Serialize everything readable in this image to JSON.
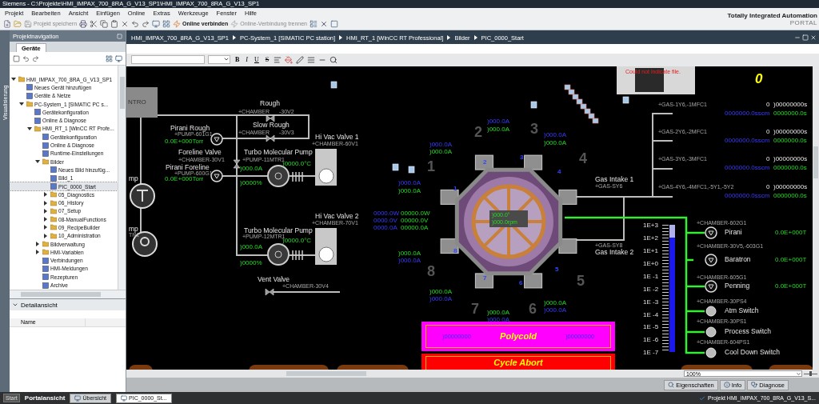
{
  "window": {
    "title": "Siemens - C:\\Projekte\\HMI_IMPAX_700_8RA_G_V13_SP1\\HMI_IMPAX_700_8RA_G_V13_SP1"
  },
  "menu": [
    "Projekt",
    "Bearbeiten",
    "Ansicht",
    "Einfügen",
    "Online",
    "Extras",
    "Werkzeuge",
    "Fenster",
    "Hilfe"
  ],
  "branding": {
    "title": "Totally Integrated Automation",
    "subtitle": "PORTAL"
  },
  "toolbar": [
    {
      "label": "Projekt speichern",
      "disabled": true
    },
    {
      "label": "Online verbinden",
      "disabled": false
    },
    {
      "label": "Online-Verbindung trennen",
      "disabled": true
    }
  ],
  "side_tab": "Visualisierung",
  "project_navigation": {
    "title": "Projektnavigation",
    "tabs": [
      {
        "label": "Geräte",
        "selected": true
      }
    ],
    "tree": [
      {
        "label": "HMI_IMPAX_700_8RA_G_V13_SP1",
        "selected": false,
        "expanded": true,
        "children": [
          {
            "label": "Neues Gerät hinzufügen",
            "selected": false
          },
          {
            "label": "Geräte & Netze",
            "selected": false
          },
          {
            "label": "PC-System_1 [SIMATIC PC s...",
            "selected": false,
            "expanded": true,
            "children": [
              {
                "label": "Gerätekonfiguration",
                "selected": false
              },
              {
                "label": "Online & Diagnose",
                "selected": false
              },
              {
                "label": "HMI_RT_1 [WinCC RT Profe...",
                "selected": false,
                "expanded": true,
                "children": [
                  {
                    "label": "Gerätekonfiguration",
                    "selected": false
                  },
                  {
                    "label": "Online & Diagnose",
                    "selected": false
                  },
                  {
                    "label": "Runtime-Einstellungen",
                    "selected": false
                  },
                  {
                    "label": "Bilder",
                    "selected": false,
                    "expanded": true,
                    "children": [
                      {
                        "label": "Neues Bild hinzufüg...",
                        "selected": false
                      },
                      {
                        "label": "Bild_1",
                        "selected": false
                      },
                      {
                        "label": "PIC_0000_Start",
                        "selected": true
                      },
                      {
                        "label": "05_Diagnostics",
                        "selected": false,
                        "expanded": false
                      },
                      {
                        "label": "06_History",
                        "selected": false,
                        "expanded": false
                      },
                      {
                        "label": "07_Setup",
                        "selected": false,
                        "expanded": false
                      },
                      {
                        "label": "08-ManualFunctions",
                        "selected": false,
                        "expanded": false
                      },
                      {
                        "label": "09_RecipeBuilder",
                        "selected": false,
                        "expanded": false
                      },
                      {
                        "label": "10_Administration",
                        "selected": false,
                        "expanded": false
                      }
                    ]
                  },
                  {
                    "label": "Bildverwaltung",
                    "selected": false,
                    "expanded": false
                  },
                  {
                    "label": "HMI-Variablen",
                    "selected": false,
                    "expanded": false
                  },
                  {
                    "label": "Verbindungen",
                    "selected": false
                  },
                  {
                    "label": "HMI-Meldungen",
                    "selected": false
                  },
                  {
                    "label": "Rezepturen",
                    "selected": false
                  },
                  {
                    "label": "Archive",
                    "selected": false
                  }
                ]
              }
            ]
          }
        ]
      }
    ]
  },
  "detail_view": {
    "title": "Detailansicht",
    "columns": [
      "Name"
    ]
  },
  "breadcrumb": [
    "HMI_IMPAX_700_8RA_G_V13_SP1",
    "PC-System_1 [SIMATIC PC station]",
    "HMI_RT_1 [WinCC RT Professional]",
    "Bilder",
    "PIC_0000_Start"
  ],
  "format_toolbar": {
    "buttons": [
      "B",
      "I",
      "U",
      "S"
    ]
  },
  "canvas": {
    "intro_button": "NTRO",
    "error_message": "Could not indicate file.",
    "counter": "0",
    "labels": [
      {
        "kind": "name",
        "text": "Rough"
      },
      {
        "kind": "tag",
        "text": "+CHAMBER"
      },
      {
        "kind": "tag",
        "text": "-30V2"
      },
      {
        "kind": "name",
        "text": "Slow Rough"
      },
      {
        "kind": "tag",
        "text": "+CHAMBER"
      },
      {
        "kind": "tag",
        "text": "-30V3"
      },
      {
        "kind": "name",
        "text": "Pirani Rough"
      },
      {
        "kind": "tag",
        "text": "+PUMP-601G1"
      },
      {
        "kind": "actual",
        "text": "0.0E+000Torr"
      },
      {
        "kind": "name",
        "text": "Hi Vac Valve 1"
      },
      {
        "kind": "tag",
        "text": "+CHAMBER-60V1"
      },
      {
        "kind": "name",
        "text": "Foreline Valve"
      },
      {
        "kind": "tag",
        "text": "+CHAMBER-30V1"
      },
      {
        "kind": "name",
        "text": "Turbo Molecular Pump"
      },
      {
        "kind": "tag",
        "text": "+PUMP-11MTR1"
      },
      {
        "kind": "actual",
        "text": ")0000.0°C"
      },
      {
        "kind": "name",
        "text": "Pirani Foreline"
      },
      {
        "kind": "tag",
        "text": "+PUMP-600G1"
      },
      {
        "kind": "actual",
        "text": "0.0E+000Torr"
      },
      {
        "kind": "actual",
        "text": ")000.0A"
      },
      {
        "kind": "actual",
        "text": ")0000%"
      },
      {
        "kind": "name",
        "text": "mp"
      },
      {
        "kind": "name",
        "text": "mp"
      },
      {
        "kind": "tag",
        "text": "TR1"
      },
      {
        "kind": "name",
        "text": "Hi Vac Valve 2"
      },
      {
        "kind": "tag",
        "text": "+CHAMBER-70V1"
      },
      {
        "kind": "name",
        "text": "Turbo Molecular Pump"
      },
      {
        "kind": "tag",
        "text": "+PUMP-12MTR1"
      },
      {
        "kind": "actual",
        "text": ")0000.0°C"
      },
      {
        "kind": "actual",
        "text": ")000.0A"
      },
      {
        "kind": "actual",
        "text": ")0000%"
      },
      {
        "kind": "name",
        "text": "Vent Valve"
      },
      {
        "kind": "tag",
        "text": "+CHAMBER-30V4"
      },
      {
        "kind": "setpoint",
        "text": ")000.0A"
      },
      {
        "kind": "actual",
        "text": ")000.0A"
      },
      {
        "kind": "setpoint",
        "text": ")000.0A"
      },
      {
        "kind": "setpoint",
        "text": ")000.0A"
      },
      {
        "kind": "actual",
        "text": ")000.0A"
      },
      {
        "kind": "actual",
        "text": ")000.0A"
      },
      {
        "kind": "setpoint",
        "text": ")000.0A"
      },
      {
        "kind": "actual",
        "text": ")000.0A"
      },
      {
        "kind": "setpoint",
        "text": "0000.0W"
      },
      {
        "kind": "actual",
        "text": "00000.0W"
      },
      {
        "kind": "setpoint",
        "text": "0000.0V"
      },
      {
        "kind": "actual",
        "text": "00000.0V"
      },
      {
        "kind": "setpoint",
        "text": "0000.0A"
      },
      {
        "kind": "actual",
        "text": "00000.0A"
      },
      {
        "kind": "actual",
        "text": ")000.0A"
      },
      {
        "kind": "setpoint",
        "text": ")000.0A"
      },
      {
        "kind": "actual",
        "text": ")000.0A"
      },
      {
        "kind": "setpoint",
        "text": ")000.0A"
      },
      {
        "kind": "actual",
        "text": ")000.0A"
      },
      {
        "kind": "actual",
        "text": ")000.0A"
      },
      {
        "kind": "setpoint",
        "text": ")000.0A"
      },
      {
        "kind": "setpoint",
        "text": ")000.0A"
      },
      {
        "kind": "zone",
        "text": "1"
      },
      {
        "kind": "zone",
        "text": "2"
      },
      {
        "kind": "zone",
        "text": "3"
      },
      {
        "kind": "zone",
        "text": "4"
      },
      {
        "kind": "zone",
        "text": "5"
      },
      {
        "kind": "zone",
        "text": "7"
      },
      {
        "kind": "zone",
        "text": "6"
      },
      {
        "kind": "zone",
        "text": "8"
      },
      {
        "kind": "port",
        "text": "1"
      },
      {
        "kind": "port",
        "text": "2"
      },
      {
        "kind": "port",
        "text": "3"
      },
      {
        "kind": "port",
        "text": "4"
      },
      {
        "kind": "port",
        "text": "5"
      },
      {
        "kind": "port",
        "text": "6"
      },
      {
        "kind": "port",
        "text": "7"
      },
      {
        "kind": "port",
        "text": "8"
      },
      {
        "kind": "name",
        "text": "Gas Intake 1"
      },
      {
        "kind": "tag",
        "text": "+GAS-SY6"
      },
      {
        "kind": "tag",
        "text": "+GAS-SY8"
      },
      {
        "kind": "name",
        "text": "Gas Intake 2"
      },
      {
        "kind": "tag",
        "text": "+GAS-1Y6,-1MFC1"
      },
      {
        "kind": "value",
        "text": "0"
      },
      {
        "kind": "value",
        "text": ")00000000s"
      },
      {
        "kind": "setpoint",
        "text": "0000000.0sscm"
      },
      {
        "kind": "actual",
        "text": "0000000.0s"
      },
      {
        "kind": "tag",
        "text": "+GAS-2Y6,-2MFC1"
      },
      {
        "kind": "value",
        "text": "0"
      },
      {
        "kind": "value",
        "text": ")00000000s"
      },
      {
        "kind": "setpoint",
        "text": "0000000.0sscm"
      },
      {
        "kind": "actual",
        "text": "0000000.0s"
      },
      {
        "kind": "tag",
        "text": "+GAS-3Y6,-3MFC1"
      },
      {
        "kind": "value",
        "text": "0"
      },
      {
        "kind": "value",
        "text": ")00000000s"
      },
      {
        "kind": "setpoint",
        "text": "0000000.0sscm"
      },
      {
        "kind": "actual",
        "text": "0000000.0s"
      },
      {
        "kind": "tag",
        "text": "+GAS-4Y6,-4MFC1,-5Y1,-5Y2"
      },
      {
        "kind": "value",
        "text": "0"
      },
      {
        "kind": "value",
        "text": ")00000000s"
      },
      {
        "kind": "setpoint",
        "text": "0000000.0sscm"
      },
      {
        "kind": "actual",
        "text": "0000000.0s"
      },
      {
        "kind": "scale",
        "text": "1E+3"
      },
      {
        "kind": "scale",
        "text": "1E+2"
      },
      {
        "kind": "scale",
        "text": "1E+1"
      },
      {
        "kind": "scale",
        "text": "1E+0"
      },
      {
        "kind": "scale",
        "text": "1E -1"
      },
      {
        "kind": "scale",
        "text": "1E -2"
      },
      {
        "kind": "scale",
        "text": "1E -3"
      },
      {
        "kind": "scale",
        "text": "1E -4"
      },
      {
        "kind": "scale",
        "text": "1E -5"
      },
      {
        "kind": "scale",
        "text": "1E -6"
      },
      {
        "kind": "scale",
        "text": "1E -7"
      },
      {
        "kind": "tag",
        "text": "+CHAMBER-602G1"
      },
      {
        "kind": "name",
        "text": "Pirani"
      },
      {
        "kind": "actual",
        "text": "0.0E+000T"
      },
      {
        "kind": "tag",
        "text": "+CHAMBER-30V5,-603G1"
      },
      {
        "kind": "name",
        "text": "Baratron"
      },
      {
        "kind": "actual",
        "text": "0.0E+000T"
      },
      {
        "kind": "tag",
        "text": "+CHAMBER-605G1"
      },
      {
        "kind": "name",
        "text": "Penning"
      },
      {
        "kind": "actual",
        "text": "0.0E+000T"
      },
      {
        "kind": "tag",
        "text": "+CHAMBER-30PS4"
      },
      {
        "kind": "name",
        "text": "Atm Switch"
      },
      {
        "kind": "tag",
        "text": "+CHAMBER-30PS1"
      },
      {
        "kind": "name",
        "text": "Process Switch"
      },
      {
        "kind": "tag",
        "text": "+CHAMBER-604PS1"
      },
      {
        "kind": "name",
        "text": "Cool Down Switch"
      }
    ],
    "rotor": {
      "angle": ")000.0°",
      "speed": ")000.0rpm"
    },
    "pressure_bar": {
      "level": 0.9
    },
    "polycold": {
      "title": "Polycold",
      "left": ")00000000",
      "right": ")00000000"
    },
    "cycle_abort": "Cycle Abort"
  },
  "zoom": "100%",
  "zoom_slider": {
    "level": 0.5
  },
  "inspector_tabs": [
    "Eigenschaften",
    "Info",
    "Diagnose"
  ],
  "taskbar": {
    "start": "Start",
    "portal": "Portalansicht",
    "items": [
      {
        "label": "Übersicht",
        "selected": false
      },
      {
        "label": "PIC_0000_St...",
        "selected": true
      }
    ],
    "project": "Projekt HMI_IMPAX_700_8RA_G_V13_S..."
  }
}
